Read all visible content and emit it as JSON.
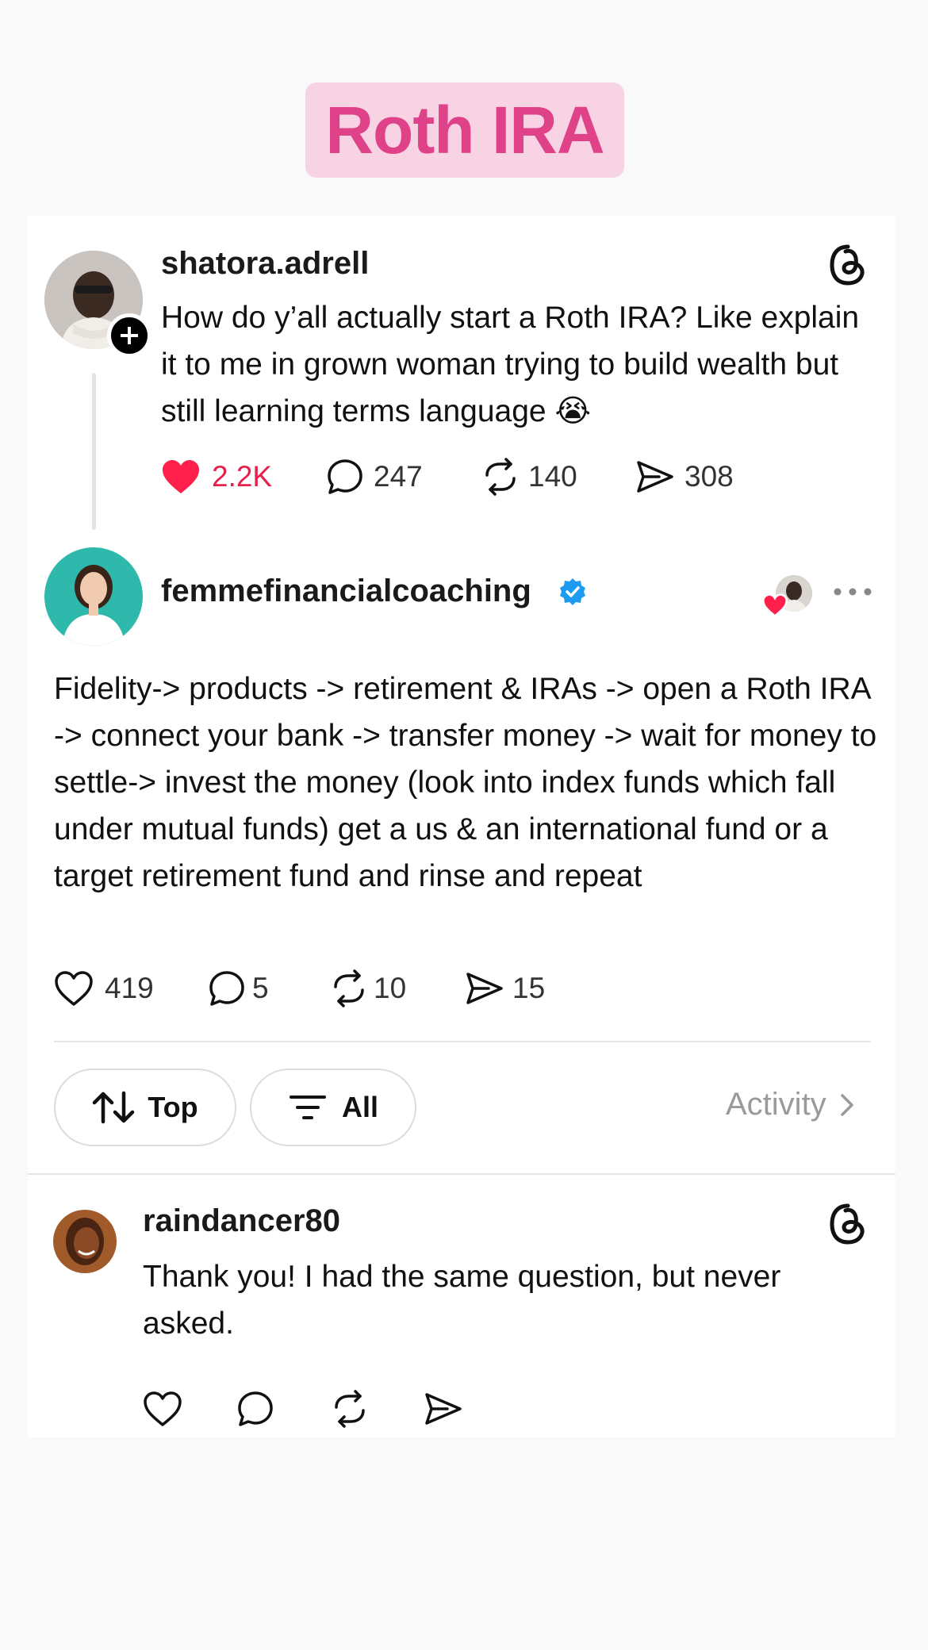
{
  "header": {
    "title": "Roth IRA"
  },
  "post": {
    "username": "shatora.adrell",
    "text": "How do y’all actually start a Roth IRA? Like explain it to me in grown woman trying to build wealth but still learning terms language",
    "emoji": "😭",
    "likes": "2.2K",
    "replies": "247",
    "reposts": "140",
    "shares": "308",
    "liked": true
  },
  "reply": {
    "username": "femmefinancialcoaching",
    "verified": true,
    "text": "Fidelity-> products -> retirement & IRAs -> open a Roth IRA -> connect your bank -> transfer money -> wait for money to settle-> invest the money (look into index funds which fall under mutual funds) get a us & an international fund or a target retirement fund and rinse and repeat",
    "likes": "419",
    "replies": "5",
    "reposts": "10",
    "shares": "15",
    "more_icon": "ellipsis-icon"
  },
  "filters": {
    "sort_label": "Top",
    "filter_label": "All",
    "activity_label": "Activity"
  },
  "comment": {
    "username": "raindancer80",
    "text": "Thank you! I had the same question, but never asked."
  },
  "colors": {
    "accent_pink": "#e0428a",
    "badge_bg": "#f8d3e3",
    "like_red": "#ff1f4b",
    "verified_blue": "#1d9bf0"
  }
}
